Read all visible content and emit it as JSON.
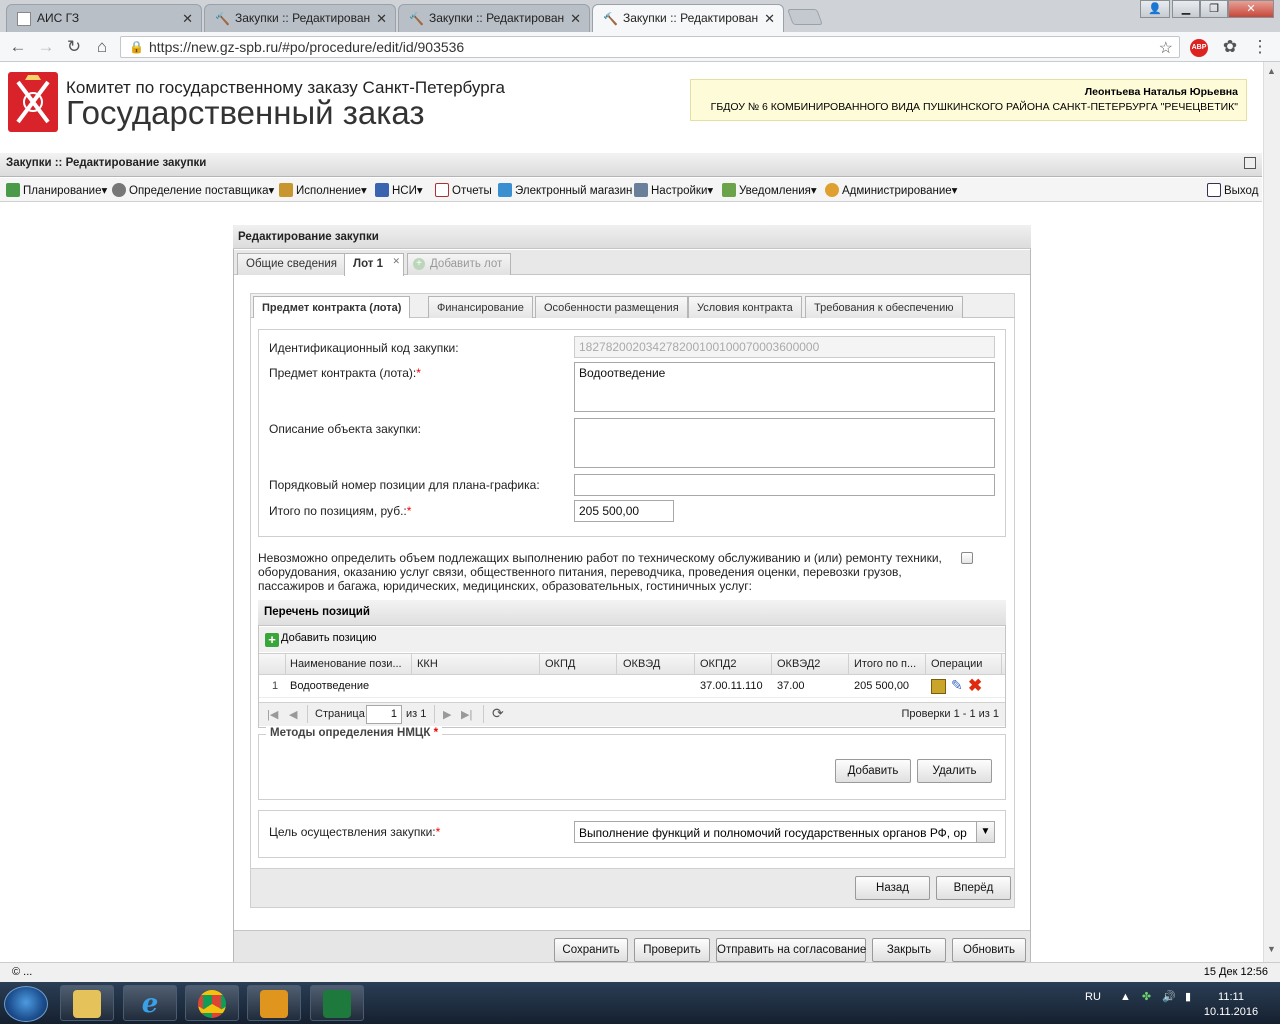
{
  "browser": {
    "tabs": [
      {
        "label": "АИС ГЗ"
      },
      {
        "label": "Закупки :: Редактирован"
      },
      {
        "label": "Закупки :: Редактирован"
      },
      {
        "label": "Закупки :: Редактирован"
      }
    ],
    "url": "https://new.gz-spb.ru/#po/procedure/edit/id/903536",
    "abp": "ABP"
  },
  "header": {
    "org_line1": "Комитет по государственному заказу Санкт-Петербурга",
    "org_line2": "Государственный заказ",
    "user_name": "Леонтьева Наталья Юрьевна",
    "user_org": "ГБДОУ № 6 КОМБИНИРОВАННОГО ВИДА ПУШКИНСКОГО РАЙОНА САНКТ-ПЕТЕРБУРГА \"РЕЧЕЦВЕТИК\""
  },
  "appbar": {
    "title": "Закупки :: Редактирование закупки"
  },
  "menu": {
    "items": [
      {
        "label": "Планирование",
        "arrow": "▾"
      },
      {
        "label": "Определение поставщика",
        "arrow": "▾"
      },
      {
        "label": "Исполнение",
        "arrow": "▾"
      },
      {
        "label": "НСИ",
        "arrow": "▾"
      },
      {
        "label": "Отчеты",
        "arrow": ""
      },
      {
        "label": "Электронный магазин",
        "arrow": ""
      },
      {
        "label": "Настройки",
        "arrow": "▾"
      },
      {
        "label": "Уведомления",
        "arrow": "▾"
      },
      {
        "label": "Администрирование",
        "arrow": "▾"
      }
    ],
    "exit": "Выход"
  },
  "panel": {
    "title": "Редактирование закупки",
    "tabs": {
      "general": "Общие сведения",
      "lot1": "Лот 1",
      "add_lot": "Добавить лот"
    },
    "subtabs": [
      "Предмет контракта (лота)",
      "Финансирование",
      "Особенности размещения",
      "Условия контракта",
      "Требования к обеспечению"
    ]
  },
  "form": {
    "ikz_label": "Идентификационный код закупки:",
    "ikz_value": "182782002034278200100100070003600000",
    "subject_label": "Предмет контракта (лота):",
    "subject_value": "Водоотведение",
    "desc_label": "Описание объекта закупки:",
    "desc_value": "",
    "plan_pos_label": "Порядковый номер позиции для плана-графика:",
    "plan_pos_value": "",
    "total_label": "Итого по позициям, руб.:",
    "total_value": "205 500,00",
    "required_mark": "*",
    "notice": "Невозможно определить объем подлежащих выполнению работ по техническому обслуживанию и (или) ремонту техники, оборудования, оказанию услуг связи, общественного питания, переводчика, проведения оценки, перевозки грузов, пассажиров и багажа, юридических, медицинских, образовательных, гостиничных услуг:"
  },
  "positions": {
    "title": "Перечень позиций",
    "add_label": "Добавить позицию",
    "columns": [
      "Наименование пози...",
      "ККН",
      "ОКПД",
      "ОКВЭД",
      "ОКПД2",
      "ОКВЭД2",
      "Итого по п...",
      "Операции"
    ],
    "rows": [
      {
        "num": "1",
        "name": "Водоотведение",
        "kkn": "",
        "okpd": "",
        "okved": "",
        "okpd2": "37.00.11.110",
        "okved2": "37.00",
        "total": "205 500,00"
      }
    ],
    "pager": {
      "page_label": "Страница",
      "page_value": "1",
      "of_label": "из 1",
      "summary": "Проверки 1 - 1 из 1"
    }
  },
  "nmck": {
    "legend": "Методы определения НМЦК",
    "add": "Добавить",
    "remove": "Удалить"
  },
  "goal": {
    "label": "Цель осуществления закупки:",
    "value": "Выполнение функций и полномочий государственных органов РФ, ор"
  },
  "nav": {
    "back": "Назад",
    "next": "Вперёд"
  },
  "footer_buttons": {
    "save": "Сохранить",
    "check": "Проверить",
    "send": "Отправить на согласование",
    "close": "Закрыть",
    "refresh": "Обновить"
  },
  "status": {
    "left": "© ...",
    "right": "15 Дек 12:56"
  },
  "taskbar": {
    "lang": "RU",
    "time": "11:11",
    "date": "10.11.2016"
  },
  "colors": {
    "brand_red": "#d8232a",
    "required": "#e00000",
    "notice_bg": "#fefbd8"
  }
}
